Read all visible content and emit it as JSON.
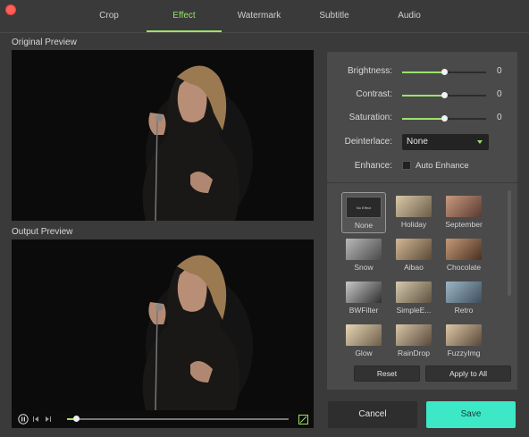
{
  "tabs": [
    "Crop",
    "Effect",
    "Watermark",
    "Subtitle",
    "Audio"
  ],
  "active_tab": "Effect",
  "labels": {
    "original_preview": "Original Preview",
    "output_preview": "Output Preview"
  },
  "adjustments": {
    "brightness": {
      "label": "Brightness:",
      "value": "0",
      "level": 0.5
    },
    "contrast": {
      "label": "Contrast:",
      "value": "0",
      "level": 0.5
    },
    "saturation": {
      "label": "Saturation:",
      "value": "0",
      "level": 0.5
    },
    "deinterlace": {
      "label": "Deinterlace:",
      "selected": "None"
    },
    "enhance": {
      "label": "Enhance:",
      "checkbox_label": "Auto Enhance",
      "checked": false
    }
  },
  "effects": [
    {
      "name": "None",
      "thumb_text": "No Effect",
      "colors": [
        "#2a2a2a",
        "#2a2a2a"
      ]
    },
    {
      "name": "Holiday",
      "colors": [
        "#d9c9a8",
        "#6b5c4a"
      ]
    },
    {
      "name": "September",
      "colors": [
        "#c99a80",
        "#5a3a30"
      ]
    },
    {
      "name": "Snow",
      "colors": [
        "#b9b9b9",
        "#4a4a4a"
      ]
    },
    {
      "name": "Aibao",
      "colors": [
        "#d2b896",
        "#5b4a38"
      ]
    },
    {
      "name": "Chocolate",
      "colors": [
        "#c49a76",
        "#4a3022"
      ]
    },
    {
      "name": "BWFilter",
      "colors": [
        "#c8c8c8",
        "#303030"
      ]
    },
    {
      "name": "SimpleE...",
      "colors": [
        "#d6c9ad",
        "#5e5240"
      ]
    },
    {
      "name": "Retro",
      "colors": [
        "#9cb6c6",
        "#3f4f5c"
      ]
    },
    {
      "name": "Glow",
      "colors": [
        "#e6d6b6",
        "#6e5e48"
      ]
    },
    {
      "name": "RainDrop",
      "colors": [
        "#d9c6a8",
        "#57483a"
      ]
    },
    {
      "name": "FuzzyImg",
      "colors": [
        "#dcc8a6",
        "#5a4838"
      ]
    }
  ],
  "selected_effect": "None",
  "buttons": {
    "reset": "Reset",
    "apply_all": "Apply to All",
    "cancel": "Cancel",
    "save": "Save"
  },
  "playback": {
    "progress": 0.04
  },
  "colors": {
    "accent": "#9be36a",
    "save": "#3de8c6"
  }
}
